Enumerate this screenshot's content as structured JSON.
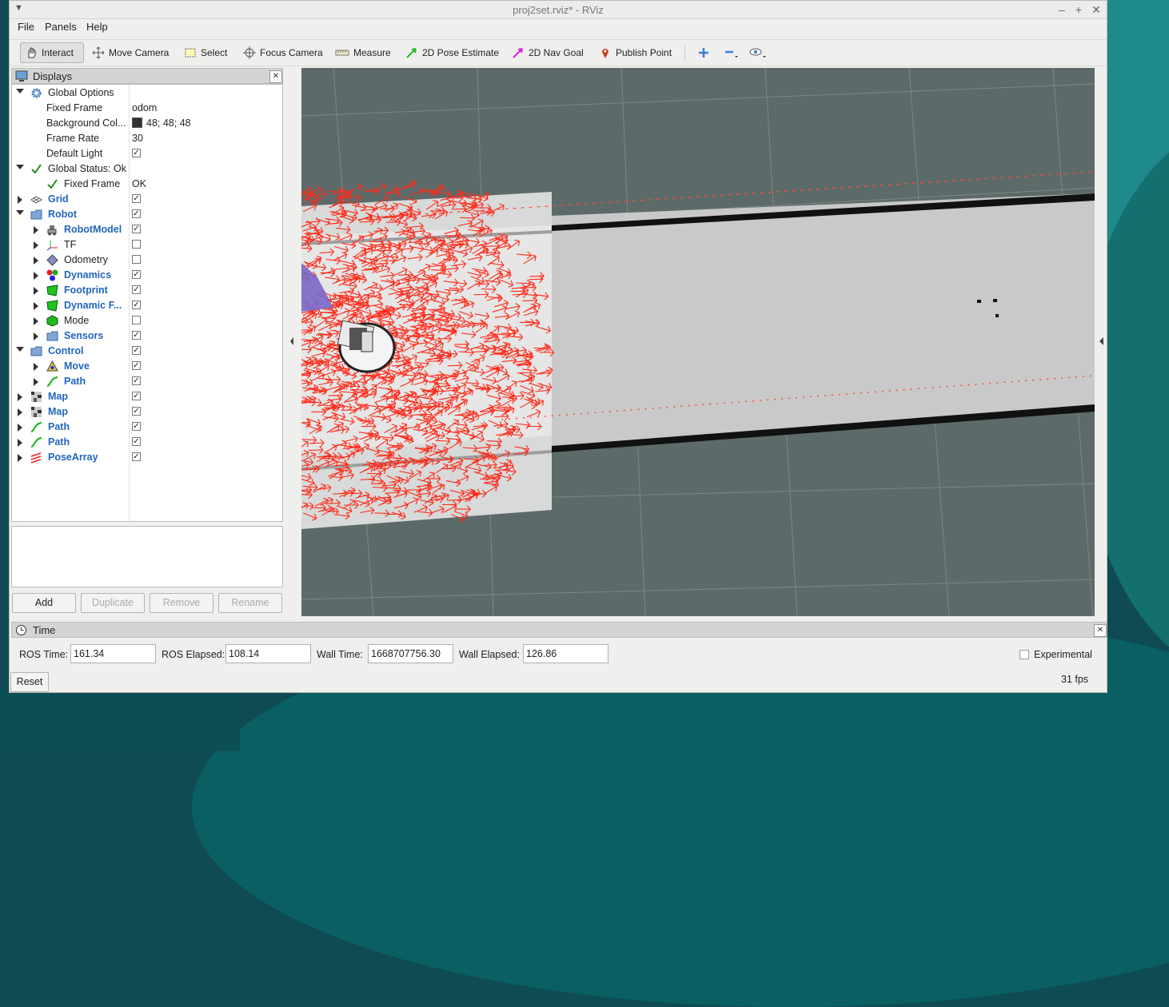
{
  "window": {
    "title": "proj2set.rviz* - RViz"
  },
  "menu": [
    "File",
    "Panels",
    "Help"
  ],
  "toolbar": {
    "interact": "Interact",
    "move_camera": "Move Camera",
    "select": "Select",
    "focus_camera": "Focus Camera",
    "measure": "Measure",
    "pose_estimate": "2D Pose Estimate",
    "nav_goal": "2D Nav Goal",
    "publish_point": "Publish Point"
  },
  "displays": {
    "title": "Displays",
    "global_options": "Global Options",
    "fixed_frame_label": "Fixed Frame",
    "fixed_frame_value": "odom",
    "bg_color_label": "Background Col...",
    "bg_color_value": "48; 48; 48",
    "frame_rate_label": "Frame Rate",
    "frame_rate_value": "30",
    "default_light_label": "Default Light",
    "global_status": "Global Status: Ok",
    "status_fixed_frame": "Fixed Frame",
    "status_fixed_frame_value": "OK",
    "items": [
      "Grid",
      "Robot",
      "RobotModel",
      "TF",
      "Odometry",
      "Dynamics",
      "Footprint",
      "Dynamic F...",
      "Mode",
      "Sensors",
      "Control",
      "Move",
      "Path",
      "Map",
      "Map",
      "Path",
      "Path",
      "PoseArray"
    ],
    "checked": [
      true,
      true,
      true,
      false,
      false,
      true,
      true,
      true,
      false,
      true,
      true,
      true,
      true,
      true,
      true,
      true,
      true,
      true
    ]
  },
  "buttons": {
    "add": "Add",
    "duplicate": "Duplicate",
    "remove": "Remove",
    "rename": "Rename"
  },
  "time": {
    "title": "Time",
    "ros_time_label": "ROS Time:",
    "ros_time": "161.34",
    "ros_elapsed_label": "ROS Elapsed:",
    "ros_elapsed": "108.14",
    "wall_time_label": "Wall Time:",
    "wall_time": "1668707756.30",
    "wall_elapsed_label": "Wall Elapsed:",
    "wall_elapsed": "126.86",
    "experimental": "Experimental",
    "reset": "Reset",
    "fps": "31 fps"
  },
  "colors": {
    "accent_link": "#2266bb",
    "view_background": "#5c6b69",
    "pose_arrows": "#ff2a1a"
  }
}
